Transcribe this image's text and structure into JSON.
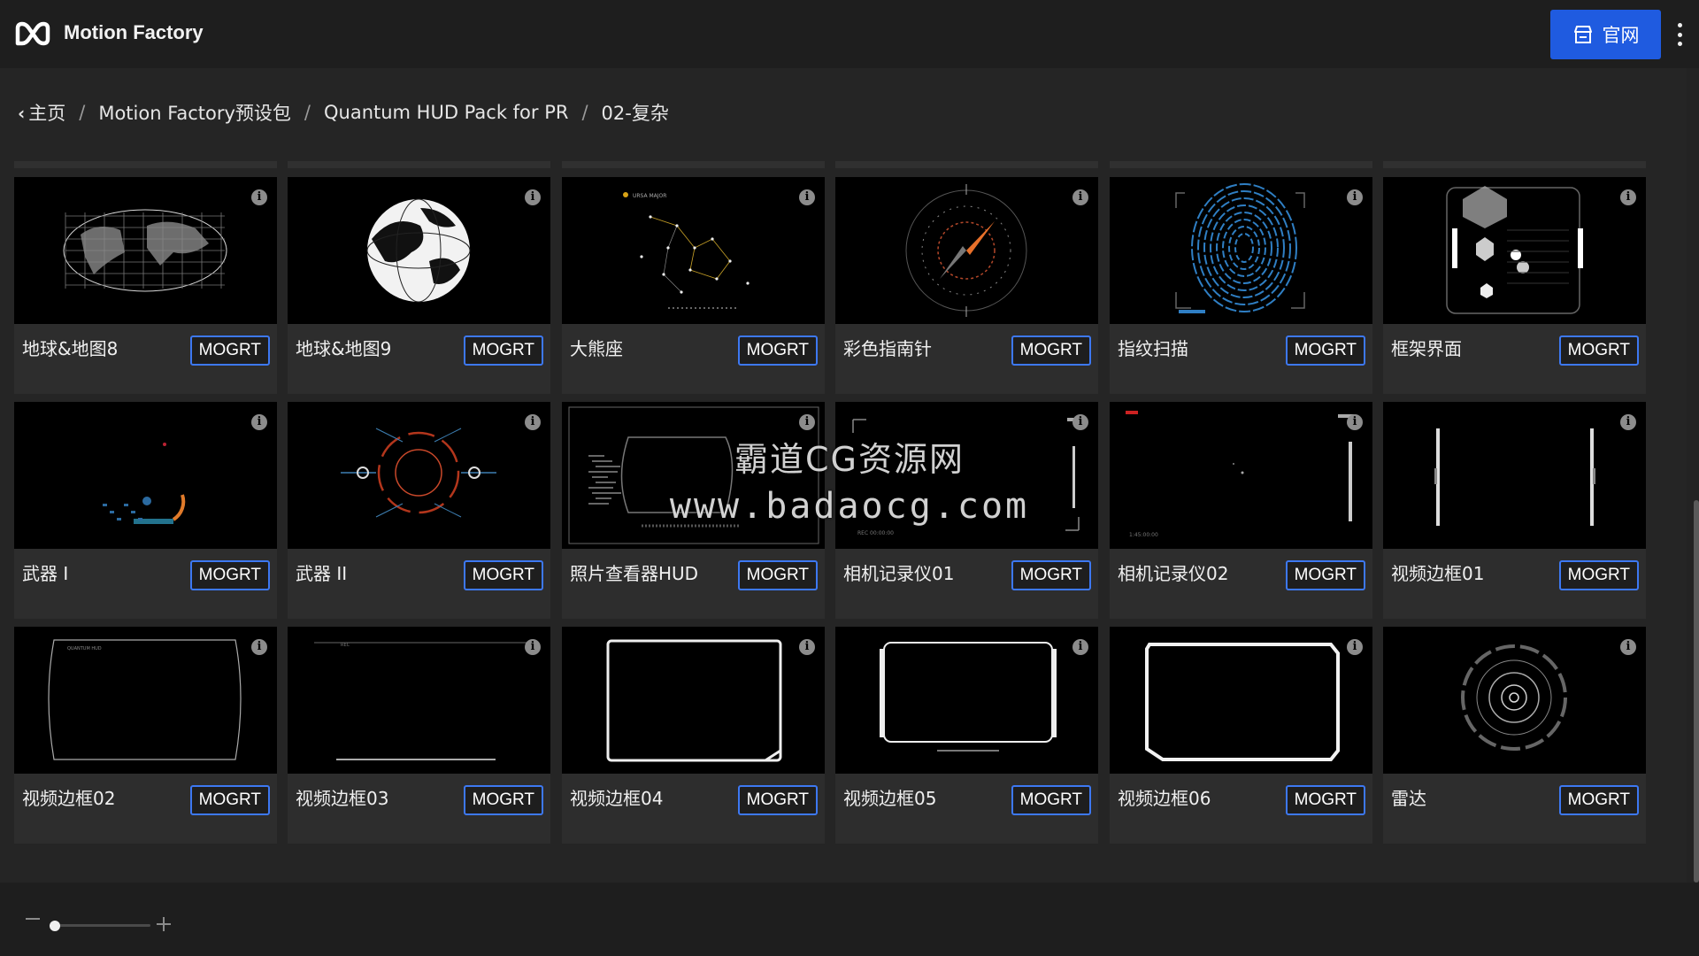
{
  "app": {
    "title": "Motion Factory",
    "logo_icon": "motion-factory-logo-icon",
    "official_button": {
      "label": "官网",
      "icon": "store-icon",
      "color": "#1f5be0"
    },
    "menu_icon": "more-vertical-icon"
  },
  "breadcrumb": {
    "items": [
      "主页",
      "Motion Factory预设包",
      "Quantum HUD Pack for PR",
      "02-复杂"
    ],
    "separator": "/",
    "back_icon": "chevron-left-icon"
  },
  "items": [
    {
      "name": "地球&地图8",
      "badge": "MOGRT",
      "thumb": "world-map-grid"
    },
    {
      "name": "地球&地图9",
      "badge": "MOGRT",
      "thumb": "globe"
    },
    {
      "name": "大熊座",
      "badge": "MOGRT",
      "thumb": "constellation"
    },
    {
      "name": "彩色指南针",
      "badge": "MOGRT",
      "thumb": "compass"
    },
    {
      "name": "指纹扫描",
      "badge": "MOGRT",
      "thumb": "fingerprint"
    },
    {
      "name": "框架界面",
      "badge": "MOGRT",
      "thumb": "frame-interface"
    },
    {
      "name": "武器 I",
      "badge": "MOGRT",
      "thumb": "weapon-1"
    },
    {
      "name": "武器 II",
      "badge": "MOGRT",
      "thumb": "weapon-2"
    },
    {
      "name": "照片查看器HUD",
      "badge": "MOGRT",
      "thumb": "photo-viewer"
    },
    {
      "name": "相机记录仪01",
      "badge": "MOGRT",
      "thumb": "camera-recorder-1"
    },
    {
      "name": "相机记录仪02",
      "badge": "MOGRT",
      "thumb": "camera-recorder-2"
    },
    {
      "name": "视频边框01",
      "badge": "MOGRT",
      "thumb": "video-frame-1"
    },
    {
      "name": "视频边框02",
      "badge": "MOGRT",
      "thumb": "video-frame-2"
    },
    {
      "name": "视频边框03",
      "badge": "MOGRT",
      "thumb": "video-frame-3"
    },
    {
      "name": "视频边框04",
      "badge": "MOGRT",
      "thumb": "video-frame-4"
    },
    {
      "name": "视频边框05",
      "badge": "MOGRT",
      "thumb": "video-frame-5"
    },
    {
      "name": "视频边框06",
      "badge": "MOGRT",
      "thumb": "video-frame-6"
    },
    {
      "name": "雷达",
      "badge": "MOGRT",
      "thumb": "radar"
    }
  ],
  "watermark": {
    "line1": "霸道CG资源网",
    "line2": "www.badaocg.com"
  },
  "footer": {
    "zoom_level": 0.05,
    "zoom_minus_icon": "minus-icon",
    "zoom_plus_icon": "plus-icon"
  },
  "colors": {
    "accent": "#3d78f2",
    "background": "#252525",
    "card": "#2d2d2d",
    "bar": "#1e1e1e"
  }
}
